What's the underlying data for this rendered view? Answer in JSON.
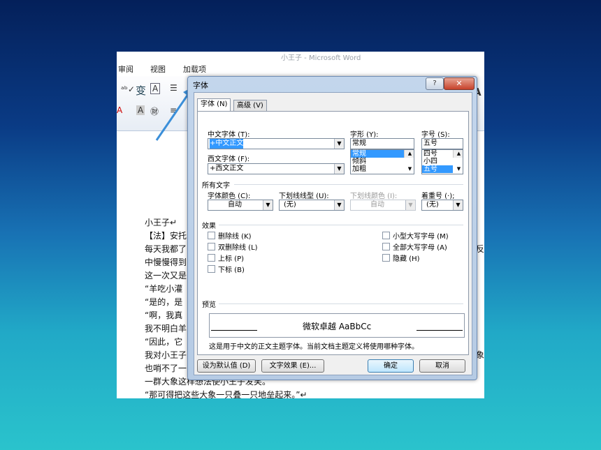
{
  "app": {
    "title_faded": "小王子 - Microsoft Word"
  },
  "menu": [
    "审阅",
    "视图",
    "加载项"
  ],
  "document": {
    "lines": [
      "小王子↵",
      "【法】安托",
      "每天我都了",
      "中慢慢得到",
      "这一次又是",
      "“羊吃小灌",
      "“是的，是",
      "“啊，我真",
      "我不明白羊",
      "“因此，它",
      "我对小王子",
      "也哨不了一",
      "一群大象这样想法使小王子发笑。",
      "“那可得把这些大象一只叠一只地垒起来。”↵"
    ],
    "right_fragments": [
      "反",
      "象"
    ]
  },
  "dialog": {
    "title": "字体",
    "help": "?",
    "close": "✕",
    "tabs": [
      "字体 (N)",
      "高级 (V)"
    ],
    "chinese_font_label": "中文字体 (T):",
    "chinese_font_value": "+中文正文",
    "western_font_label": "西文字体 (F):",
    "western_font_value": "+西文正文",
    "style_label": "字形 (Y):",
    "style_value": "常规",
    "style_options": [
      "常规",
      "倾斜",
      "加粗"
    ],
    "size_label": "字号 (S):",
    "size_value": "五号",
    "size_options": [
      "四号",
      "小四",
      "五号"
    ],
    "all_text_label": "所有文字",
    "font_color_label": "字体颜色 (C):",
    "font_color_value": "自动",
    "underline_type_label": "下划线线型 (U):",
    "underline_type_value": "(无)",
    "underline_color_label": "下划线颜色 (I):",
    "underline_color_value": "自动",
    "emphasis_label": "着重号 (·);",
    "emphasis_value": "(无)",
    "effects_label": "效果",
    "effects_left": [
      "删除线 (K)",
      "双删除线 (L)",
      "上标 (P)",
      "下标 (B)"
    ],
    "effects_right": [
      "小型大写字母 (M)",
      "全部大写字母 (A)",
      "隐藏 (H)"
    ],
    "preview_label": "预览",
    "preview_text": "微软卓越 AaBbCc",
    "note": "这是用于中文的正文主题字体。当前文档主题定义将使用哪种字体。",
    "buttons": {
      "default": "设为默认值 (D)",
      "text_effects": "文字效果 (E)...",
      "ok": "确定",
      "cancel": "取消"
    }
  },
  "colors": {
    "arrow": "#3b8fd9",
    "selection": "#3399ff",
    "close_red": "#c7412a"
  }
}
